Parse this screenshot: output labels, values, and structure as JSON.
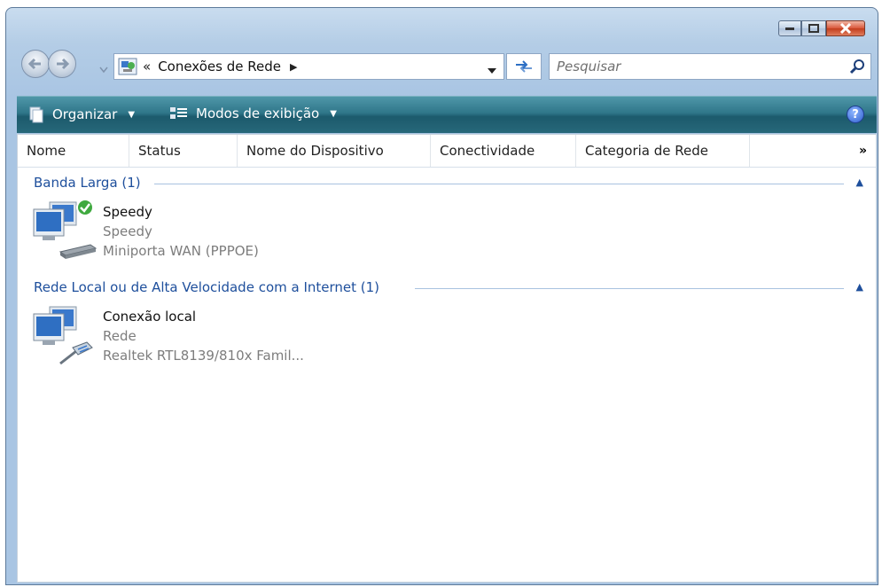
{
  "address": {
    "chevrons": "«",
    "current": "Conexões de Rede",
    "separator": "▶"
  },
  "search": {
    "placeholder": "Pesquisar"
  },
  "toolbar": {
    "organize_label": "Organizar",
    "views_label": "Modos de exibição",
    "help_label": "?"
  },
  "columns": [
    "Nome",
    "Status",
    "Nome do Dispositivo",
    "Conectividade",
    "Categoria de Rede"
  ],
  "columns_more": "»",
  "groups": [
    {
      "title": "Banda Larga (1)",
      "items": [
        {
          "name": "Speedy",
          "status": "Speedy",
          "device": "Miniporta WAN (PPPOE)",
          "connected": true
        }
      ]
    },
    {
      "title": "Rede Local ou de Alta Velocidade com a Internet (1)",
      "items": [
        {
          "name": "Conexão local",
          "status": "Rede",
          "device": "Realtek RTL8139/810x Famil...",
          "connected": false
        }
      ]
    }
  ],
  "colors": {
    "toolbar": "#2f7689",
    "group_text": "#1e4f9c",
    "close_button": "#c23d1d"
  }
}
